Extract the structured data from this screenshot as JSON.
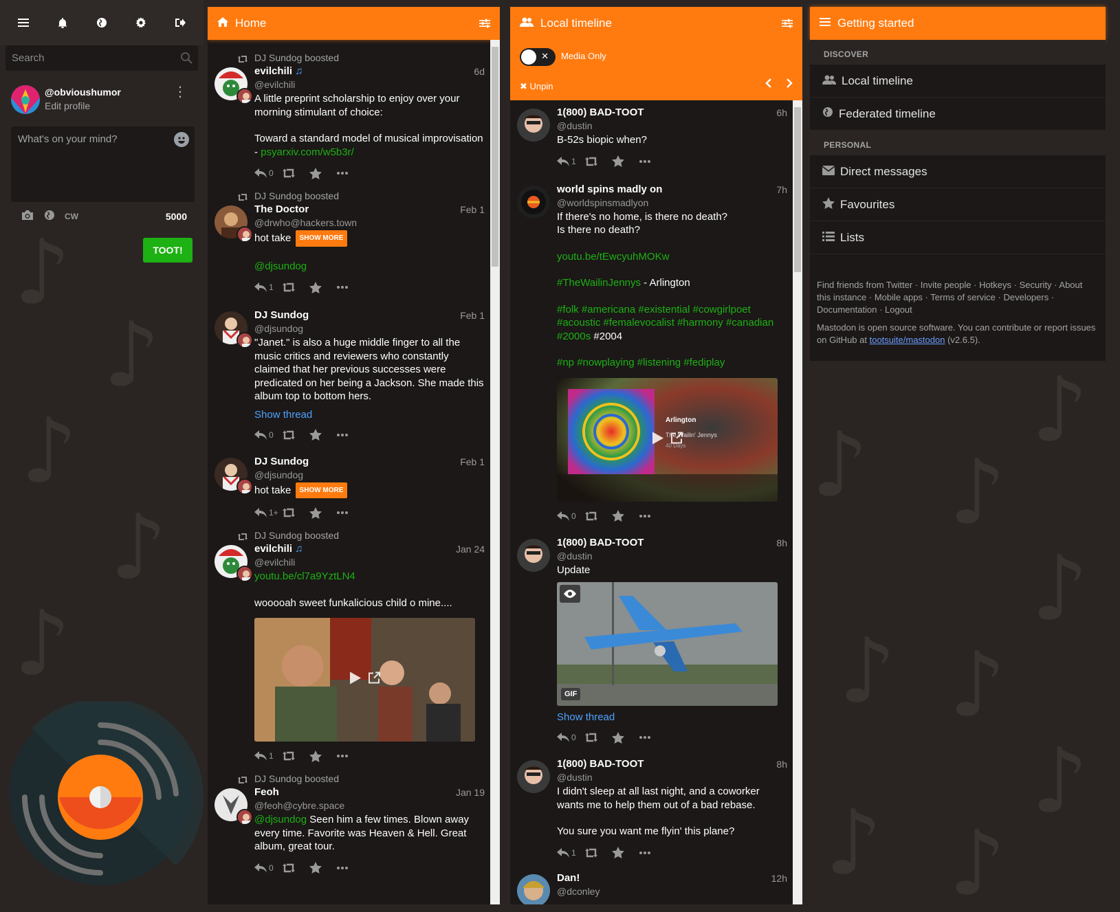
{
  "nav": {
    "items": [
      "menu-icon",
      "bell-icon",
      "globe-icon",
      "gear-icon",
      "sign-out-icon"
    ]
  },
  "search": {
    "placeholder": "Search"
  },
  "account": {
    "handle": "@obvioushumor",
    "edit": "Edit profile"
  },
  "compose": {
    "placeholder": "What's on your mind?",
    "cw": "CW",
    "count": "5000",
    "submit": "TOOT!"
  },
  "home": {
    "title": "Home",
    "statuses": [
      {
        "boosted_by": "DJ Sundog boosted",
        "name": "evilchili",
        "acct": "@evilchili",
        "time": "6d",
        "paragraphs": [
          "A little preprint scholarship to enjoy over your morning stimulant of choice:"
        ],
        "p2_text": "Toward a standard model of musical improvisation - ",
        "p2_link": "psyarxiv.com/w5b3r/",
        "replies": "0"
      },
      {
        "boosted_by": "DJ Sundog boosted",
        "name": "The Doctor",
        "acct": "@drwho@hackers.town",
        "time": "Feb 1",
        "cw_text": "hot take",
        "show_more": "SHOW MORE",
        "mention": "@djsundog",
        "replies": "1"
      },
      {
        "name": "DJ Sundog",
        "acct": "@djsundog",
        "time": "Feb 1",
        "text": "\"Janet.\" is also a huge middle finger to all the music critics and reviewers who constantly claimed that her previous successes were predicated on her being a Jackson. She made this album top to bottom hers.",
        "show_thread": "Show thread",
        "replies": "0"
      },
      {
        "name": "DJ Sundog",
        "acct": "@djsundog",
        "time": "Feb 1",
        "cw_text": "hot take",
        "show_more": "SHOW MORE",
        "replies": "1+"
      },
      {
        "boosted_by": "DJ Sundog boosted",
        "name": "evilchili",
        "acct": "@evilchili",
        "time": "Jan 24",
        "link": "youtu.be/cl7a9YztLN4",
        "text": "wooooah sweet funkalicious child o mine....",
        "replies": "1"
      },
      {
        "boosted_by": "DJ Sundog boosted",
        "name": "Feoh",
        "acct": "@feoh@cybre.space",
        "time": "Jan 19",
        "mention": "@djsundog",
        "text": " Seen him a few times. Blown away every time. Favorite was Heaven & Hell. Great album, great tour.",
        "replies": "0"
      }
    ]
  },
  "local": {
    "title": "Local timeline",
    "media_only": "Media Only",
    "unpin": "Unpin",
    "statuses": [
      {
        "name": "1(800) BAD-TOOT",
        "acct": "@dustin",
        "time": "6h",
        "text": "B-52s biopic when?",
        "replies": "1"
      },
      {
        "name": "world spins madly on",
        "acct": "@worldspinsmadlyon",
        "time": "7h",
        "line1": "If there's no home, is there no death?",
        "line2": "Is there no death?",
        "link": "youtu.be/tEwcyuhMOKw",
        "tag_artist": "#TheWailinJennys",
        "song": " - Arlington",
        "tags1": "#folk #americana #existential #cowgirlpoet",
        "tags2": "#acoustic #femalevocalist #harmony #canadian",
        "tags3": "#2000s",
        "tags3_plain": " #2004",
        "tags4": "#np #nowplaying #listening #fediplay",
        "media_title": "Arlington",
        "media_sub": "The Wailin' Jennys",
        "media_sub2": "40 Days",
        "replies": "0"
      },
      {
        "name": "1(800) BAD-TOOT",
        "acct": "@dustin",
        "time": "8h",
        "text": "Update",
        "badge": "GIF",
        "show_thread": "Show thread",
        "replies": "0"
      },
      {
        "name": "1(800) BAD-TOOT",
        "acct": "@dustin",
        "time": "8h",
        "text": "I didn't sleep at all last night, and a coworker wants me to help them out of a bad rebase.",
        "text2": "You sure you want me flyin' this plane?",
        "replies": "1"
      },
      {
        "name": "Dan!",
        "acct": "@dconley",
        "time": "12h"
      }
    ]
  },
  "getting_started": {
    "title": "Getting started",
    "discover": "DISCOVER",
    "local": "Local timeline",
    "federated": "Federated timeline",
    "personal": "PERSONAL",
    "dm": "Direct messages",
    "favourites": "Favourites",
    "lists": "Lists",
    "footer_links": [
      "Find friends from Twitter",
      "Invite people",
      "Hotkeys",
      "Security",
      "About this instance",
      "Mobile apps",
      "Terms of service",
      "Developers",
      "Documentation",
      "Logout"
    ],
    "footer_text": "Mastodon is open source software. You can contribute or report issues on GitHub at ",
    "footer_repo": "tootsuite/mastodon",
    "footer_version": " (v2.6.5)."
  },
  "colors": {
    "accent": "#ff7b10",
    "toot_button": "#1db113",
    "link": "#1db113",
    "thread": "#4ea2ff"
  }
}
